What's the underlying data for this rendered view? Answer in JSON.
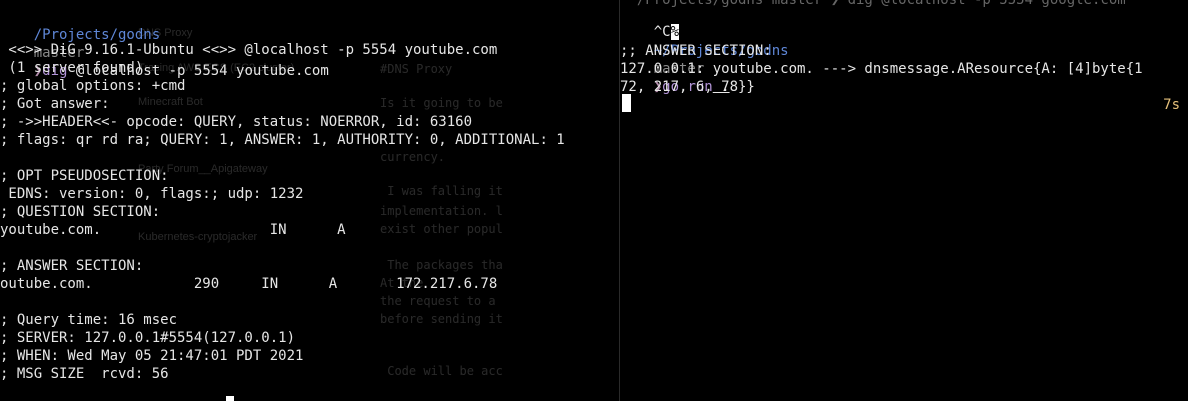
{
  "left_pane": {
    "prompt": {
      "dir": "/Projects/godns",
      "branch": "master",
      "arrow": "❯",
      "command": "dig",
      "args": " @localhost -p 5554 youtube.com"
    },
    "output": [
      " <<>> DiG 9.16.1-Ubuntu <<>> @localhost -p 5554 youtube.com",
      " (1 server found)",
      "; global options: +cmd",
      "; Got answer:",
      "; ->>HEADER<<- opcode: QUERY, status: NOERROR, id: 63160",
      "; flags: qr rd ra; QUERY: 1, ANSWER: 1, AUTHORITY: 0, ADDITIONAL: 1",
      "",
      "; OPT PSEUDOSECTION:",
      " EDNS: version: 0, flags:; udp: 1232",
      "; QUESTION SECTION:",
      "youtube.com.                    IN      A",
      "",
      "; ANSWER SECTION:",
      "outube.com.            290     IN      A       172.217.6.78",
      "",
      "; Query time: 16 msec",
      "; SERVER: 127.0.0.1#5554(127.0.0.1)",
      "; WHEN: Wed May 05 21:47:01 PDT 2021",
      "; MSG SIZE  rcvd: 56"
    ],
    "background_ghost": {
      "sidebar": [
        "DNS Proxy",
        "Tracing AWS ECS (EC2 cluster)",
        "Minecraft Bot",
        "Party Forum__Apigateway",
        "Kubernetes-cryptojacker"
      ],
      "editor": [
        "#DNS Proxy",
        "Is it going to be",
        "currency.",
        " I was falling it",
        "implementation. l",
        "exist other popul",
        " The packages tha",
        "At the",
        "the request to a",
        "before sending it",
        " Code will be acc"
      ]
    }
  },
  "right_pane": {
    "top_partial": "  /Projects/godns master ❯ dig @localhost -p 5554 google.com",
    "interrupt": "^C",
    "prompt": {
      "dir": "~/Projects/godns",
      "branch": "master",
      "arrow": "❯",
      "command": "go run",
      "args": " ."
    },
    "timer": "7s",
    "output": [
      ";; ANSWER SECTION:",
      "127.0.0.1: youtube.com. ---> dnsmessage.AResource{A: [4]byte{1",
      "72, 217, 6, 78}}"
    ]
  },
  "colors": {
    "background": "#000000",
    "text": "#e6e6e6",
    "dir": "#5f87d7",
    "branch": "#8a8a8a",
    "command": "#b294d7",
    "timer": "#e5c07b"
  }
}
